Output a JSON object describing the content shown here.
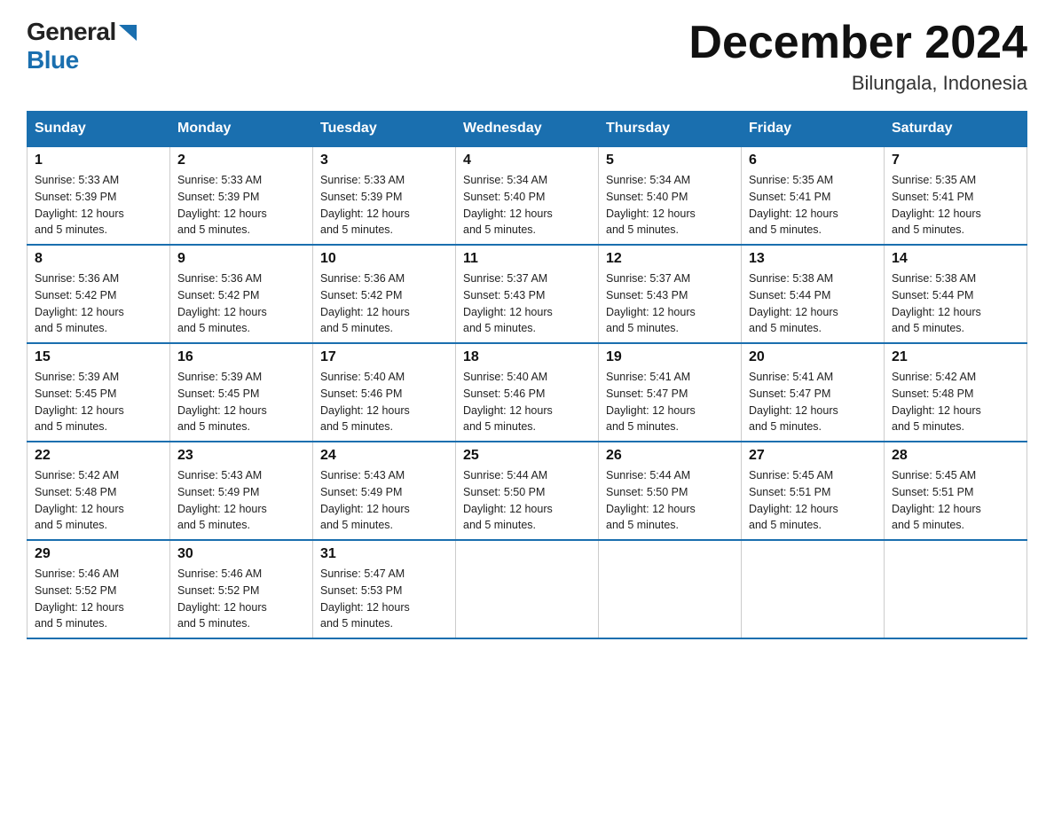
{
  "header": {
    "logo": {
      "general": "General",
      "blue": "Blue"
    },
    "title": "December 2024",
    "location": "Bilungala, Indonesia"
  },
  "days_of_week": [
    "Sunday",
    "Monday",
    "Tuesday",
    "Wednesday",
    "Thursday",
    "Friday",
    "Saturday"
  ],
  "weeks": [
    [
      {
        "day": "1",
        "sunrise": "5:33 AM",
        "sunset": "5:39 PM",
        "daylight": "12 hours and 5 minutes."
      },
      {
        "day": "2",
        "sunrise": "5:33 AM",
        "sunset": "5:39 PM",
        "daylight": "12 hours and 5 minutes."
      },
      {
        "day": "3",
        "sunrise": "5:33 AM",
        "sunset": "5:39 PM",
        "daylight": "12 hours and 5 minutes."
      },
      {
        "day": "4",
        "sunrise": "5:34 AM",
        "sunset": "5:40 PM",
        "daylight": "12 hours and 5 minutes."
      },
      {
        "day": "5",
        "sunrise": "5:34 AM",
        "sunset": "5:40 PM",
        "daylight": "12 hours and 5 minutes."
      },
      {
        "day": "6",
        "sunrise": "5:35 AM",
        "sunset": "5:41 PM",
        "daylight": "12 hours and 5 minutes."
      },
      {
        "day": "7",
        "sunrise": "5:35 AM",
        "sunset": "5:41 PM",
        "daylight": "12 hours and 5 minutes."
      }
    ],
    [
      {
        "day": "8",
        "sunrise": "5:36 AM",
        "sunset": "5:42 PM",
        "daylight": "12 hours and 5 minutes."
      },
      {
        "day": "9",
        "sunrise": "5:36 AM",
        "sunset": "5:42 PM",
        "daylight": "12 hours and 5 minutes."
      },
      {
        "day": "10",
        "sunrise": "5:36 AM",
        "sunset": "5:42 PM",
        "daylight": "12 hours and 5 minutes."
      },
      {
        "day": "11",
        "sunrise": "5:37 AM",
        "sunset": "5:43 PM",
        "daylight": "12 hours and 5 minutes."
      },
      {
        "day": "12",
        "sunrise": "5:37 AM",
        "sunset": "5:43 PM",
        "daylight": "12 hours and 5 minutes."
      },
      {
        "day": "13",
        "sunrise": "5:38 AM",
        "sunset": "5:44 PM",
        "daylight": "12 hours and 5 minutes."
      },
      {
        "day": "14",
        "sunrise": "5:38 AM",
        "sunset": "5:44 PM",
        "daylight": "12 hours and 5 minutes."
      }
    ],
    [
      {
        "day": "15",
        "sunrise": "5:39 AM",
        "sunset": "5:45 PM",
        "daylight": "12 hours and 5 minutes."
      },
      {
        "day": "16",
        "sunrise": "5:39 AM",
        "sunset": "5:45 PM",
        "daylight": "12 hours and 5 minutes."
      },
      {
        "day": "17",
        "sunrise": "5:40 AM",
        "sunset": "5:46 PM",
        "daylight": "12 hours and 5 minutes."
      },
      {
        "day": "18",
        "sunrise": "5:40 AM",
        "sunset": "5:46 PM",
        "daylight": "12 hours and 5 minutes."
      },
      {
        "day": "19",
        "sunrise": "5:41 AM",
        "sunset": "5:47 PM",
        "daylight": "12 hours and 5 minutes."
      },
      {
        "day": "20",
        "sunrise": "5:41 AM",
        "sunset": "5:47 PM",
        "daylight": "12 hours and 5 minutes."
      },
      {
        "day": "21",
        "sunrise": "5:42 AM",
        "sunset": "5:48 PM",
        "daylight": "12 hours and 5 minutes."
      }
    ],
    [
      {
        "day": "22",
        "sunrise": "5:42 AM",
        "sunset": "5:48 PM",
        "daylight": "12 hours and 5 minutes."
      },
      {
        "day": "23",
        "sunrise": "5:43 AM",
        "sunset": "5:49 PM",
        "daylight": "12 hours and 5 minutes."
      },
      {
        "day": "24",
        "sunrise": "5:43 AM",
        "sunset": "5:49 PM",
        "daylight": "12 hours and 5 minutes."
      },
      {
        "day": "25",
        "sunrise": "5:44 AM",
        "sunset": "5:50 PM",
        "daylight": "12 hours and 5 minutes."
      },
      {
        "day": "26",
        "sunrise": "5:44 AM",
        "sunset": "5:50 PM",
        "daylight": "12 hours and 5 minutes."
      },
      {
        "day": "27",
        "sunrise": "5:45 AM",
        "sunset": "5:51 PM",
        "daylight": "12 hours and 5 minutes."
      },
      {
        "day": "28",
        "sunrise": "5:45 AM",
        "sunset": "5:51 PM",
        "daylight": "12 hours and 5 minutes."
      }
    ],
    [
      {
        "day": "29",
        "sunrise": "5:46 AM",
        "sunset": "5:52 PM",
        "daylight": "12 hours and 5 minutes."
      },
      {
        "day": "30",
        "sunrise": "5:46 AM",
        "sunset": "5:52 PM",
        "daylight": "12 hours and 5 minutes."
      },
      {
        "day": "31",
        "sunrise": "5:47 AM",
        "sunset": "5:53 PM",
        "daylight": "12 hours and 5 minutes."
      },
      null,
      null,
      null,
      null
    ]
  ],
  "labels": {
    "sunrise": "Sunrise:",
    "sunset": "Sunset:",
    "daylight": "Daylight:"
  }
}
